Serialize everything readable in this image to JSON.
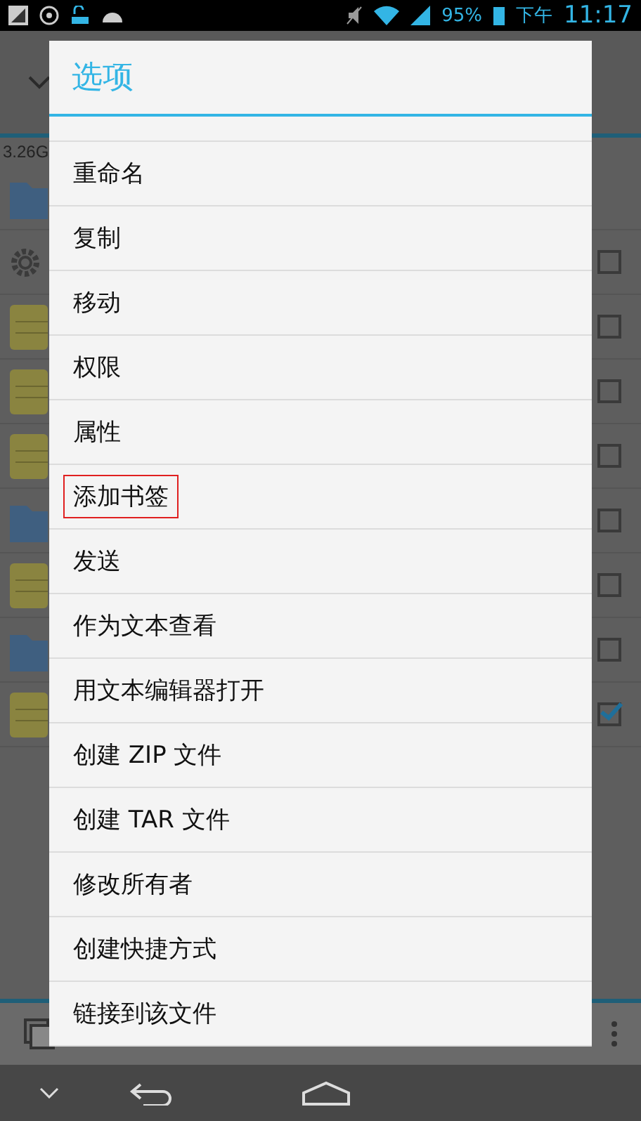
{
  "status_bar": {
    "battery": "95%",
    "period": "下午",
    "time": "11:17"
  },
  "background": {
    "storage": "3.26G",
    "rows": [
      {
        "kind": "folder"
      },
      {
        "kind": "settings",
        "checked": false
      },
      {
        "kind": "note",
        "checked": false
      },
      {
        "kind": "note",
        "checked": false
      },
      {
        "kind": "note",
        "checked": false
      },
      {
        "kind": "folder",
        "checked": false
      },
      {
        "kind": "note",
        "checked": false
      },
      {
        "kind": "folder",
        "checked": false
      },
      {
        "kind": "note",
        "checked": true
      }
    ]
  },
  "dialog": {
    "title": "选项",
    "items": [
      {
        "label": "重命名",
        "highlighted": false
      },
      {
        "label": "复制",
        "highlighted": false
      },
      {
        "label": "移动",
        "highlighted": false
      },
      {
        "label": "权限",
        "highlighted": false
      },
      {
        "label": "属性",
        "highlighted": false
      },
      {
        "label": "添加书签",
        "highlighted": true
      },
      {
        "label": "发送",
        "highlighted": false
      },
      {
        "label": "作为文本查看",
        "highlighted": false
      },
      {
        "label": "用文本编辑器打开",
        "highlighted": false
      },
      {
        "label": "创建 ZIP 文件",
        "highlighted": false
      },
      {
        "label": "创建 TAR 文件",
        "highlighted": false
      },
      {
        "label": "修改所有者",
        "highlighted": false
      },
      {
        "label": "创建快捷方式",
        "highlighted": false
      },
      {
        "label": "链接到该文件",
        "highlighted": false
      }
    ]
  }
}
